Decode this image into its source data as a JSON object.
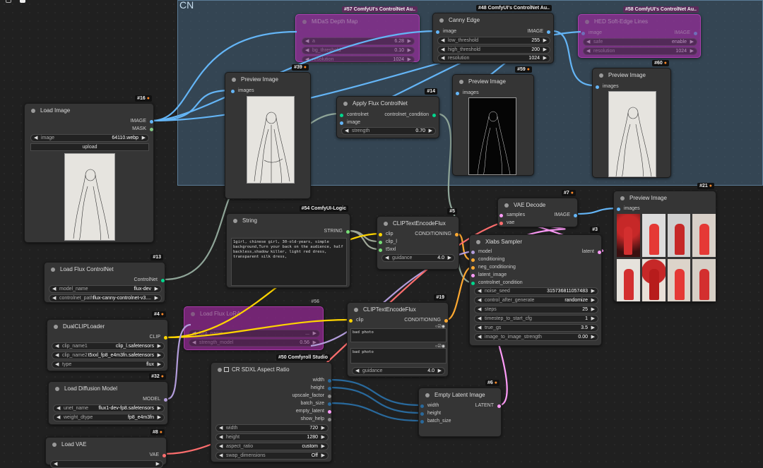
{
  "group": {
    "title": "CN"
  },
  "nodes": {
    "midas": {
      "badge": "#57 ComfyUI's ControlNet Au..",
      "title": "MiDaS Depth Map",
      "widgets": [
        {
          "label": "a",
          "value": "6.28"
        },
        {
          "label": "bg_threshold",
          "value": "0.10"
        },
        {
          "label": "resolution",
          "value": "1024"
        }
      ]
    },
    "canny": {
      "badge": "#48 ComfyUI's ControlNet Au..",
      "title": "Canny Edge",
      "in": "image",
      "out": "IMAGE",
      "widgets": [
        {
          "label": "low_threshold",
          "value": "255"
        },
        {
          "label": "high_threshold",
          "value": "200"
        },
        {
          "label": "resolution",
          "value": "1024"
        }
      ]
    },
    "hed": {
      "badge": "#58 ComfyUI's ControlNet Au..",
      "title": "HED Soft-Edge Lines",
      "in": "image",
      "out": "IMAGE",
      "widgets": [
        {
          "label": "safe",
          "value": "enable"
        },
        {
          "label": "resolution",
          "value": "1024"
        }
      ]
    },
    "preview39": {
      "badge": "#39",
      "title": "Preview Image",
      "in": "images"
    },
    "apply14": {
      "badge": "#14",
      "title": "Apply Flux ControlNet",
      "in1": "controlnet",
      "in2": "image",
      "out": "controlnet_condition",
      "widget": {
        "label": "strength",
        "value": "0.70"
      }
    },
    "preview59": {
      "badge": "#59",
      "title": "Preview Image",
      "in": "images"
    },
    "preview60": {
      "badge": "#60",
      "title": "Preview Image",
      "in": "images"
    },
    "load16": {
      "badge": "#16",
      "title": "Load Image",
      "out1": "IMAGE",
      "out2": "MASK",
      "widget": {
        "label": "image",
        "value": "64110.webp"
      },
      "upload": "upload"
    },
    "string54": {
      "badge": "#54 ComfyUI-Logic",
      "title": "String",
      "out": "STRING",
      "text": "1girl, chinese girl, 30-old-years, simple background,Turn your back on the audience, half backless,shadow killer, light red dress, transparent silk dress,"
    },
    "clip5": {
      "badge": "#5",
      "title": "CLIPTextEncodeFlux",
      "in1": "clip",
      "in2": "clip_l",
      "in3": "t5xxl",
      "out": "CONDITIONING",
      "widget": {
        "label": "guidance",
        "value": "4.0"
      }
    },
    "vae7": {
      "badge": "#7",
      "title": "VAE Decode",
      "in1": "samples",
      "in2": "vae",
      "out": "IMAGE"
    },
    "preview21": {
      "badge": "#21",
      "title": "Preview Image",
      "in": "images"
    },
    "xlabs3": {
      "badge": "#3",
      "title": "Xlabs Sampler",
      "ins": [
        "model",
        "conditioning",
        "neg_conditioning",
        "latent_image",
        "controlnet_condition"
      ],
      "out": "latent",
      "widgets": [
        {
          "label": "noise_seed",
          "value": "315736811057483"
        },
        {
          "label": "control_after_generate",
          "value": "randomize"
        },
        {
          "label": "steps",
          "value": "25"
        },
        {
          "label": "timestep_to_start_cfg",
          "value": "1"
        },
        {
          "label": "true_gs",
          "value": "3.5"
        },
        {
          "label": "image_to_image_strength",
          "value": "0.00"
        }
      ]
    },
    "flux13": {
      "badge": "#13",
      "title": "Load Flux ControlNet",
      "out": "ControlNet",
      "widgets": [
        {
          "label": "model_name",
          "value": "flux-dev"
        },
        {
          "label": "controlnet_path",
          "value": "flux-canny-controlnet-v3...."
        }
      ]
    },
    "lora56": {
      "badge": "#56",
      "title": "Load Flux LoRA",
      "widgets": [
        {
          "label": "lora_name",
          "value": "..."
        },
        {
          "label": "strength_model",
          "value": "0.56"
        }
      ]
    },
    "clip19": {
      "badge": "#19",
      "title": "CLIPTextEncodeFlux",
      "in1": "clip",
      "out": "CONDITIONING",
      "text1": "bad photo",
      "text2": "bad photo",
      "widget": {
        "label": "guidance",
        "value": "4.0"
      }
    },
    "dual4": {
      "badge": "#4",
      "title": "DualCLIPLoader",
      "out": "CLIP",
      "widgets": [
        {
          "label": "clip_name1",
          "value": "clip_l.safetensors"
        },
        {
          "label": "clip_name2",
          "value": "t5xxl_fp8_e4m3fn.safetensors"
        },
        {
          "label": "type",
          "value": "flux"
        }
      ]
    },
    "sdxl50": {
      "badge": "#50 Comfyroll Studio",
      "title": "CR SDXL Aspect Ratio",
      "outs": [
        "width",
        "height",
        "upscale_factor",
        "batch_size",
        "empty_latent",
        "show_help"
      ],
      "widgets": [
        {
          "label": "width",
          "value": "720"
        },
        {
          "label": "height",
          "value": "1280"
        },
        {
          "label": "aspect_ratio",
          "value": "custom"
        },
        {
          "label": "swap_dimensions",
          "value": "Off"
        }
      ]
    },
    "empty6": {
      "badge": "#6",
      "title": "Empty Latent Image",
      "ins": [
        "width",
        "height",
        "batch_size"
      ],
      "out": "LATENT"
    },
    "diff32": {
      "badge": "#32",
      "title": "Load Diffusion Model",
      "out": "MODEL",
      "widgets": [
        {
          "label": "unet_name",
          "value": "flux1-dev-fp8.safetensors"
        },
        {
          "label": "weight_dtype",
          "value": "fp8_e4m3fn"
        }
      ]
    },
    "vae8": {
      "badge": "#8",
      "title": "Load VAE",
      "out": "VAE"
    }
  },
  "colors": {
    "image": "#64b5f6",
    "mask": "#81c784",
    "string": "#77dd77",
    "conditioning": "#ffa931",
    "clip": "#ffd500",
    "latent": "#ff9cf9",
    "vae": "#ff6e6e",
    "int": "#29699c",
    "model": "#b39ddb",
    "controlnet": "#00d78d"
  }
}
